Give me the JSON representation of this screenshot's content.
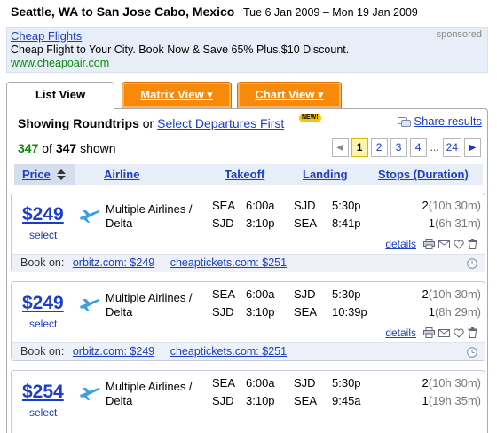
{
  "header": {
    "route": "Seattle, WA to San Jose Cabo, Mexico",
    "dates": "Tue 6 Jan 2009 – Mon 19 Jan 2009"
  },
  "ad": {
    "title": "Cheap Flights",
    "text": "Cheap Flight to Your City. Book Now & Save 65% Plus.$10 Discount.",
    "url": "www.cheapoair.com",
    "sponsored_label": "sponsored"
  },
  "tabs": {
    "list": "List View",
    "matrix": "Matrix View ▾",
    "chart": "Chart View ▾"
  },
  "summary": {
    "showing_prefix": "Showing Roundtrips",
    "or": "or",
    "select_departures": "Select Departures First",
    "new_badge": "NEW!",
    "share": "Share results",
    "count_shown": "347",
    "of": "of",
    "count_total": "347",
    "shown": "shown"
  },
  "pager": {
    "prev": "◀",
    "pages": [
      "1",
      "2",
      "3",
      "4"
    ],
    "ellipsis": "...",
    "last": "24",
    "next": "▶"
  },
  "columns": {
    "price": "Price",
    "airline": "Airline",
    "takeoff": "Takeoff",
    "landing": "Landing",
    "stops": "Stops (Duration)"
  },
  "results": [
    {
      "price": "$249",
      "select": "select",
      "airline": "Multiple Airlines / Delta",
      "out": {
        "dep": "SEA",
        "dep_time": "6:00a",
        "arr": "SJD",
        "arr_time": "5:30p",
        "stops": "2",
        "duration": "(10h 30m)"
      },
      "ret": {
        "dep": "SJD",
        "dep_time": "3:10p",
        "arr": "SEA",
        "arr_time": "8:41p",
        "stops": "1",
        "duration": "(6h 31m)"
      },
      "details": "details",
      "book_on": "Book on:",
      "book1": "orbitz.com: $249",
      "book2": "cheaptickets.com: $251"
    },
    {
      "price": "$249",
      "select": "select",
      "airline": "Multiple Airlines / Delta",
      "out": {
        "dep": "SEA",
        "dep_time": "6:00a",
        "arr": "SJD",
        "arr_time": "5:30p",
        "stops": "2",
        "duration": "(10h 30m)"
      },
      "ret": {
        "dep": "SJD",
        "dep_time": "3:10p",
        "arr": "SEA",
        "arr_time": "10:39p",
        "stops": "1",
        "duration": "(8h 29m)"
      },
      "details": "details",
      "book_on": "Book on:",
      "book1": "orbitz.com: $249",
      "book2": "cheaptickets.com: $251"
    },
    {
      "price": "$254",
      "select": "select",
      "airline": "Multiple Airlines / Delta",
      "out": {
        "dep": "SEA",
        "dep_time": "6:00a",
        "arr": "SJD",
        "arr_time": "5:30p",
        "stops": "2",
        "duration": "(10h 30m)"
      },
      "ret": {
        "dep": "SJD",
        "dep_time": "3:10p",
        "arr": "SEA",
        "arr_time": "9:45a",
        "stops": "1",
        "duration": "(19h 35m)"
      }
    }
  ],
  "colors": {
    "link": "#1a3ec8",
    "tab_orange": "#f7890b",
    "count_green": "#0a8a0a",
    "header_bg": "#e8eef8"
  }
}
